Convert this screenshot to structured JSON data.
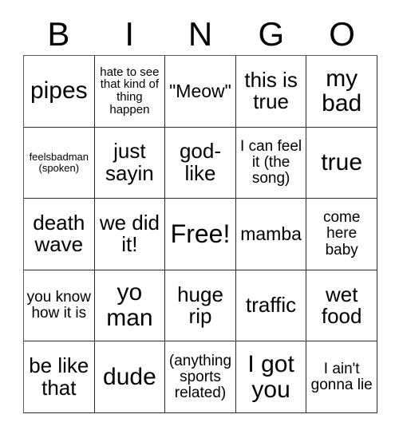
{
  "card": {
    "title": "BINGO",
    "header_letters": [
      "B",
      "I",
      "N",
      "G",
      "O"
    ],
    "grid_size": "5x5",
    "free_space": "Free!",
    "colors": {
      "background": "#ffffff",
      "text": "#000000",
      "grid_line": "#2b2b2b"
    },
    "rows": [
      [
        {
          "text": "pipes",
          "size": "lg"
        },
        {
          "text": "hate to see that kind of thing happen",
          "size": "xxs"
        },
        {
          "text": "\"Meow\"",
          "size": "sm"
        },
        {
          "text": "this is true",
          "size": "md"
        },
        {
          "text": "my bad",
          "size": "lg"
        }
      ],
      [
        {
          "text": "feelsbadman (spoken)",
          "size": "tiny"
        },
        {
          "text": "just sayin",
          "size": "md"
        },
        {
          "text": "god-like",
          "size": "md"
        },
        {
          "text": "I can feel it (the song)",
          "size": "xs"
        },
        {
          "text": "true",
          "size": "lg"
        }
      ],
      [
        {
          "text": "death wave",
          "size": "md"
        },
        {
          "text": "we did it!",
          "size": "md"
        },
        {
          "text": "Free!",
          "size": "xl"
        },
        {
          "text": "mamba",
          "size": "sm"
        },
        {
          "text": "come here baby",
          "size": "xs"
        }
      ],
      [
        {
          "text": "you know how it is",
          "size": "xs"
        },
        {
          "text": "yo man",
          "size": "lg"
        },
        {
          "text": "huge rip",
          "size": "md"
        },
        {
          "text": "traffic",
          "size": "md"
        },
        {
          "text": "wet food",
          "size": "md"
        }
      ],
      [
        {
          "text": "be like that",
          "size": "md"
        },
        {
          "text": "dude",
          "size": "lg"
        },
        {
          "text": "(anything sports related)",
          "size": "xs"
        },
        {
          "text": "I got you",
          "size": "lg"
        },
        {
          "text": "I ain't gonna lie",
          "size": "xs"
        }
      ]
    ]
  }
}
